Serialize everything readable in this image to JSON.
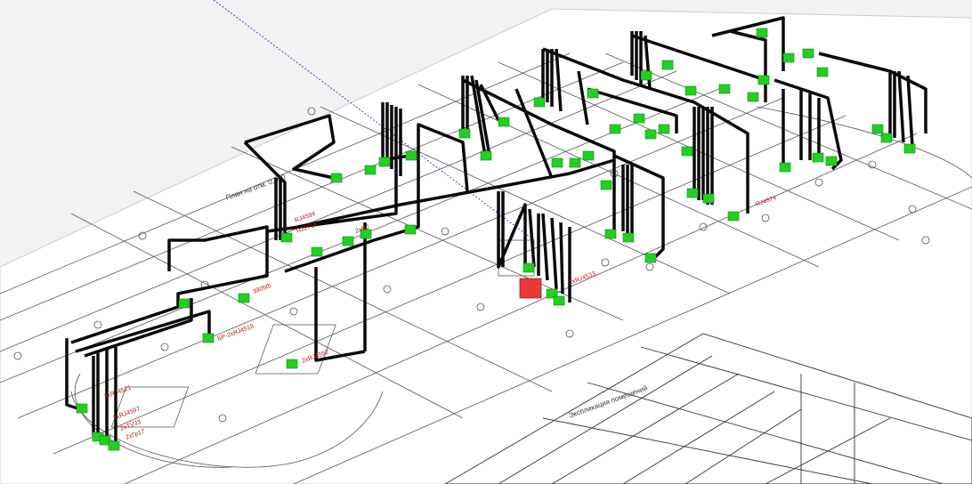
{
  "scene": {
    "background": "#f2f2f2",
    "paper_color": "#ffffff",
    "line_color": "#3a3a3a",
    "cable_color": "#0a0a0a",
    "outlet_color": "#22d022",
    "source_color": "#e83a3a",
    "label_color": "#c01818",
    "axis_color": "#3050c0"
  },
  "drawing": {
    "header_text": "Экспликация помещений",
    "left_edge_text": "План на отм. 0,000"
  },
  "labels": {
    "l1": "2xRJ4521",
    "l2": "2xRJ4597",
    "l3": "2xTV33",
    "l4": "2xГр17",
    "l5": "3905t5",
    "l6": "БР-2xRJ4519",
    "l7": "2xRJ4552",
    "l8": "RJ4594",
    "l9": "RJ2716",
    "l10": "2xRJ",
    "l11": "2xRJ4533",
    "l12": "RJ4574"
  }
}
